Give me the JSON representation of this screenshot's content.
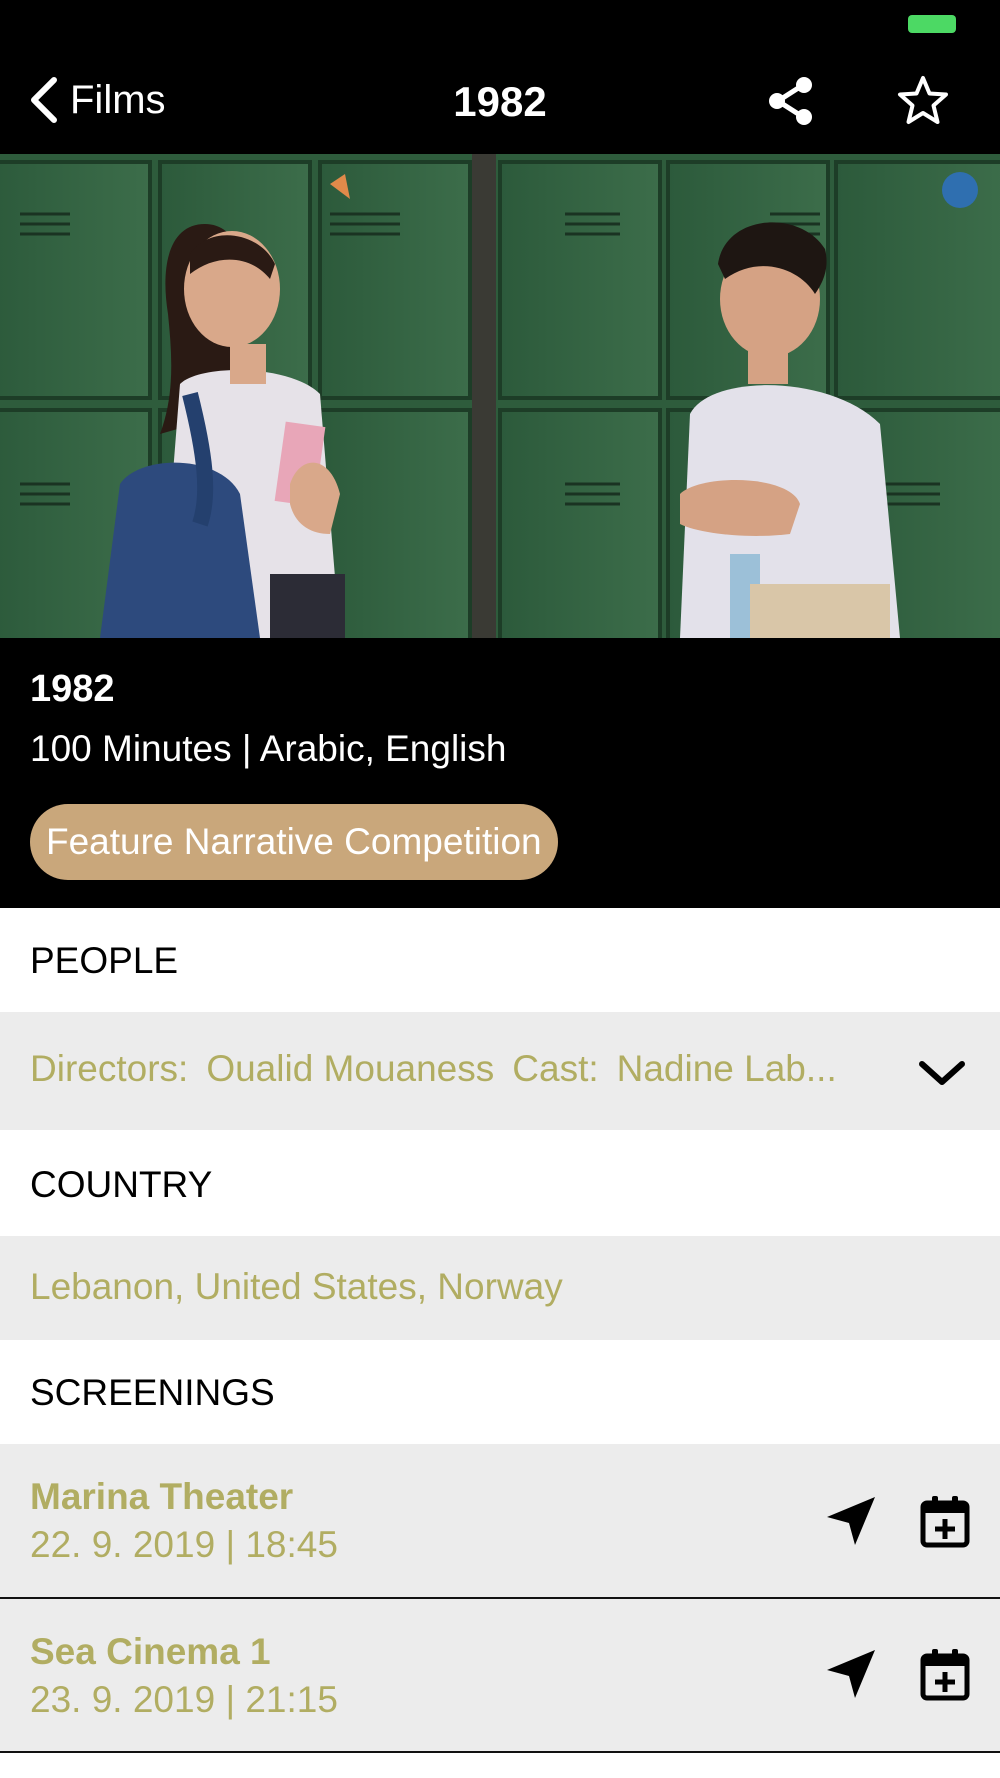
{
  "nav": {
    "back_label": "Films",
    "title": "1982"
  },
  "hero_image": {
    "description": "two children facing each other in front of green lockers"
  },
  "film": {
    "title": "1982",
    "meta": "100 Minutes | Arabic, English",
    "category": "Feature Narrative Competition"
  },
  "sections": {
    "people": "PEOPLE",
    "country": "COUNTRY",
    "screenings": "SCREENINGS"
  },
  "people": {
    "directors_label": "Directors:",
    "directors_value": "Oualid Mouaness",
    "cast_label": "Cast:",
    "cast_value": "Nadine Lab..."
  },
  "country": "Lebanon, United States, Norway",
  "screenings": [
    {
      "venue": "Marina Theater",
      "datetime": "22. 9. 2019 | 18:45"
    },
    {
      "venue": "Sea Cinema 1",
      "datetime": "23. 9. 2019 | 21:15"
    }
  ],
  "icons": {
    "back": "chevron-left-icon",
    "share": "share-icon",
    "favorite": "star-outline-icon",
    "expand": "chevron-down-icon",
    "directions": "location-arrow-icon",
    "calendar": "calendar-add-icon"
  },
  "colors": {
    "accent_olive": "#b1ad62",
    "category_pill": "#c9a77b",
    "battery": "#4cd964",
    "row_grey": "#ececec"
  }
}
